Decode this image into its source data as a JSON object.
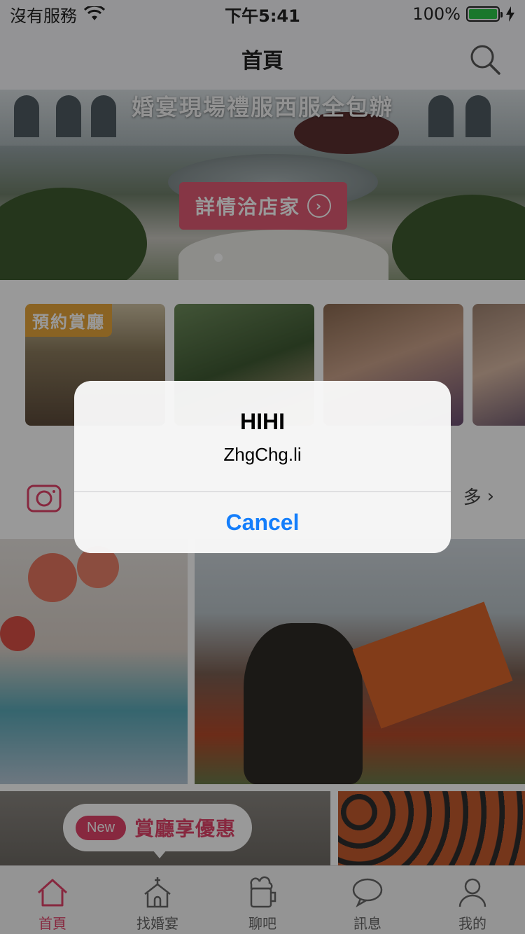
{
  "status_bar": {
    "carrier": "沒有服務",
    "time": "下午5:41",
    "battery_percent": "100%",
    "battery_level": 1.0
  },
  "nav": {
    "title": "首頁",
    "search_icon": "search-icon"
  },
  "banner": {
    "tagline": "婚宴現場禮服西服全包辦",
    "cta_label": "詳情洽店家",
    "cta_arrow": "›"
  },
  "cards": [
    {
      "tag": "預約賞廳"
    },
    {
      "tag": ""
    },
    {
      "tag": ""
    },
    {
      "tag": ""
    }
  ],
  "section": {
    "icon": "camera-icon",
    "more_label": "多",
    "more_arrow": "›"
  },
  "promo": {
    "badge": "New",
    "text": "賞廳享優惠"
  },
  "tabs": [
    {
      "label": "首頁",
      "icon": "home-icon",
      "active": true
    },
    {
      "label": "找婚宴",
      "icon": "chapel-icon",
      "active": false
    },
    {
      "label": "聊吧",
      "icon": "beer-mug-icon",
      "active": false
    },
    {
      "label": "訊息",
      "icon": "chat-bubble-icon",
      "active": false
    },
    {
      "label": "我的",
      "icon": "user-icon",
      "active": false
    }
  ],
  "alert": {
    "title": "HIHI",
    "message": "ZhgChg.li",
    "cancel_label": "Cancel"
  },
  "colors": {
    "accent": "#e2436a",
    "alert_button": "#147efb",
    "tag_orange": "#e6a63b"
  }
}
